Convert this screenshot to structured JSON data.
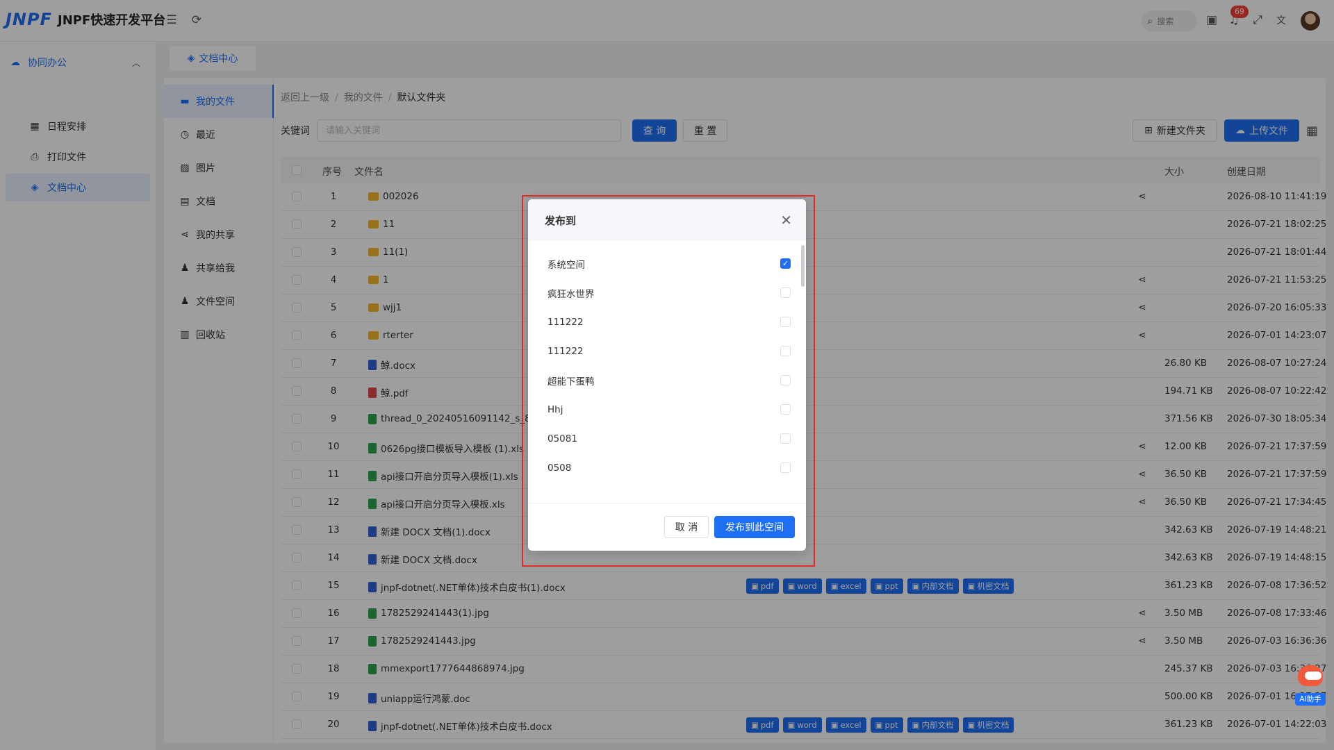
{
  "app": {
    "logo_mark": "JNPF",
    "title": "JNPF快速开发平台"
  },
  "header": {
    "search_placeholder": "搜索",
    "notification_count": "69"
  },
  "sidebar": {
    "group_label": "协同办公",
    "items": [
      {
        "label": "日程安排",
        "icon": "calendar-icon"
      },
      {
        "label": "打印文件",
        "icon": "printer-icon"
      },
      {
        "label": "文档中心",
        "icon": "layers-icon",
        "active": true
      }
    ]
  },
  "tabs": [
    {
      "label": "文档中心"
    }
  ],
  "file_menu": [
    {
      "label": "我的文件",
      "icon": "folder-icon",
      "active": true
    },
    {
      "label": "最近",
      "icon": "clock-icon"
    },
    {
      "label": "图片",
      "icon": "image-icon"
    },
    {
      "label": "文档",
      "icon": "document-icon"
    },
    {
      "label": "我的共享",
      "icon": "share-icon"
    },
    {
      "label": "共享给我",
      "icon": "user-share-icon"
    },
    {
      "label": "文件空间",
      "icon": "user-space-icon"
    },
    {
      "label": "回收站",
      "icon": "trash-icon"
    }
  ],
  "breadcrumb": {
    "back": "返回上一级",
    "parent": "我的文件",
    "current": "默认文件夹",
    "sep": "/"
  },
  "filter": {
    "keyword_label": "关键词",
    "keyword_placeholder": "请输入关键词",
    "query_label": "查 询",
    "reset_label": "重 置"
  },
  "toolbar": {
    "new_folder_label": "新建文件夹",
    "upload_label": "上传文件"
  },
  "table": {
    "headers": {
      "index": "序号",
      "name": "文件名",
      "size": "大小",
      "created": "创建日期"
    },
    "tag_labels": [
      "pdf",
      "word",
      "excel",
      "ppt",
      "内部文档",
      "机密文档"
    ],
    "rows": [
      {
        "index": "1",
        "name": "002026",
        "type": "folder",
        "share": true,
        "size": "",
        "date": "2026-08-10 11:41:19"
      },
      {
        "index": "2",
        "name": "11",
        "type": "folder",
        "share": false,
        "size": "",
        "date": "2026-07-21 18:02:25"
      },
      {
        "index": "3",
        "name": "11(1)",
        "type": "folder",
        "share": false,
        "size": "",
        "date": "2026-07-21 18:01:44"
      },
      {
        "index": "4",
        "name": "1",
        "type": "folder",
        "share": true,
        "size": "",
        "date": "2026-07-21 11:53:25"
      },
      {
        "index": "5",
        "name": "wjj1",
        "type": "folder",
        "share": true,
        "size": "",
        "date": "2026-07-20 16:05:33"
      },
      {
        "index": "6",
        "name": "rterter",
        "type": "folder",
        "share": true,
        "size": "",
        "date": "2026-07-01 14:23:07"
      },
      {
        "index": "7",
        "name": "鲸.docx",
        "type": "word",
        "share": false,
        "size": "26.80 KB",
        "date": "2026-08-07 10:27:24"
      },
      {
        "index": "8",
        "name": "鲸.pdf",
        "type": "pdf",
        "share": false,
        "size": "194.71 KB",
        "date": "2026-08-07 10:22:42"
      },
      {
        "index": "9",
        "name": "thread_0_20240516091142_s_818984",
        "type": "img",
        "share": false,
        "size": "371.56 KB",
        "date": "2026-07-30 18:05:34"
      },
      {
        "index": "10",
        "name": "0626pg接口模板导入模板 (1).xls",
        "type": "xls",
        "share": true,
        "size": "12.00 KB",
        "date": "2026-07-21 17:37:59"
      },
      {
        "index": "11",
        "name": "api接口开启分页导入模板(1).xls",
        "type": "xls",
        "share": true,
        "size": "36.50 KB",
        "date": "2026-07-21 17:37:59"
      },
      {
        "index": "12",
        "name": "api接口开启分页导入模板.xls",
        "type": "xls",
        "share": true,
        "size": "36.50 KB",
        "date": "2026-07-21 17:34:45"
      },
      {
        "index": "13",
        "name": "新建 DOCX 文档(1).docx",
        "type": "word",
        "share": false,
        "size": "342.63 KB",
        "date": "2026-07-19 14:48:21"
      },
      {
        "index": "14",
        "name": "新建 DOCX 文档.docx",
        "type": "word",
        "share": false,
        "size": "342.63 KB",
        "date": "2026-07-19 14:48:15"
      },
      {
        "index": "15",
        "name": "jnpf-dotnet(.NET单体)技术白皮书(1).docx",
        "type": "word",
        "share": false,
        "tags": true,
        "size": "361.23 KB",
        "date": "2026-07-08 17:36:52"
      },
      {
        "index": "16",
        "name": "1782529241443(1).jpg",
        "type": "img",
        "share": true,
        "size": "3.50 MB",
        "date": "2026-07-08 17:33:46"
      },
      {
        "index": "17",
        "name": "1782529241443.jpg",
        "type": "img",
        "share": true,
        "size": "3.50 MB",
        "date": "2026-07-03 16:36:36"
      },
      {
        "index": "18",
        "name": "mmexport1777644868974.jpg",
        "type": "img",
        "share": false,
        "size": "245.37 KB",
        "date": "2026-07-03 16:36:27"
      },
      {
        "index": "19",
        "name": "uniapp运行鸿蒙.doc",
        "type": "word",
        "share": false,
        "size": "500.00 KB",
        "date": "2026-07-01 16:27:37"
      },
      {
        "index": "20",
        "name": "jnpf-dotnet(.NET单体)技术白皮书.docx",
        "type": "word",
        "share": false,
        "tags": true,
        "size": "361.23 KB",
        "date": "2026-07-01 14:22:03"
      }
    ]
  },
  "dialog": {
    "title": "发布到",
    "options": [
      {
        "label": "系统空间",
        "checked": true
      },
      {
        "label": "疯狂水世界",
        "checked": false
      },
      {
        "label": "111222",
        "checked": false
      },
      {
        "label": "111222",
        "checked": false
      },
      {
        "label": "超能下蛋鸭",
        "checked": false
      },
      {
        "label": "Hhj",
        "checked": false
      },
      {
        "label": "05081",
        "checked": false
      },
      {
        "label": "0508",
        "checked": false
      }
    ],
    "cancel_label": "取 消",
    "confirm_label": "发布到此空间"
  },
  "assistant": {
    "label": "AI助手"
  },
  "colors": {
    "primary": "#1e6ff5",
    "badge": "#f5403a",
    "highlight_box": "#e52a2a"
  }
}
